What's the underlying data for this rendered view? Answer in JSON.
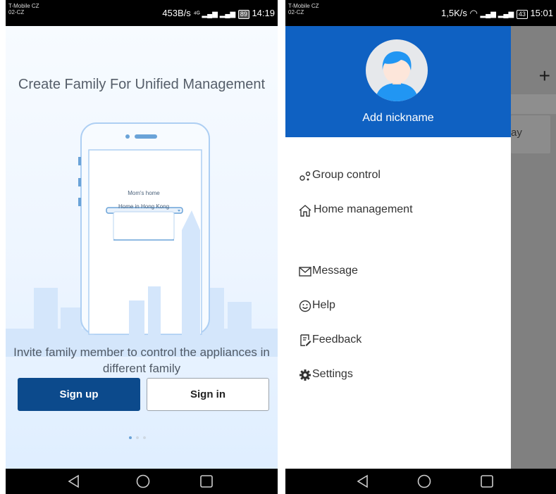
{
  "left": {
    "status": {
      "carrier_line1": "T-Mobile CZ",
      "carrier_line2": "02-CZ",
      "speed": "453B/s",
      "indicators": "⁴ᴳ ▂▄▆ ▂▄▆",
      "battery": "89",
      "time": "14:19"
    },
    "title": "Create Family For Unified Management",
    "illustration": {
      "home_option_1": "Mom's home",
      "home_option_2": "Home in Hong Kong"
    },
    "invite_text": "Invite family member to control the appliances in different family",
    "signup_label": "Sign up",
    "signin_label": "Sign in",
    "pagination": {
      "count": 3,
      "active": 0
    }
  },
  "right": {
    "status": {
      "carrier_line1": "T-Mobile CZ",
      "carrier_line2": "02-CZ",
      "speed": "1,5K/s",
      "indicators": "▂▄▆ ▂▄▆",
      "battery": "43",
      "time": "15:01"
    },
    "behind_plus": "+",
    "behind_card_text": "ay",
    "drawer": {
      "nickname": "Add nickname",
      "menu": [
        {
          "icon": "group-control-icon",
          "label": "Group control"
        },
        {
          "icon": "home-icon",
          "label": "Home management"
        },
        {
          "icon": "envelope-icon",
          "label": "Message"
        },
        {
          "icon": "smile-icon",
          "label": "Help"
        },
        {
          "icon": "feedback-icon",
          "label": "Feedback"
        },
        {
          "icon": "gear-icon",
          "label": "Settings"
        }
      ]
    }
  },
  "colors": {
    "header_blue": "#0f61c2",
    "signup_blue": "#0c4a8c",
    "overlay_gray": "#808080"
  }
}
